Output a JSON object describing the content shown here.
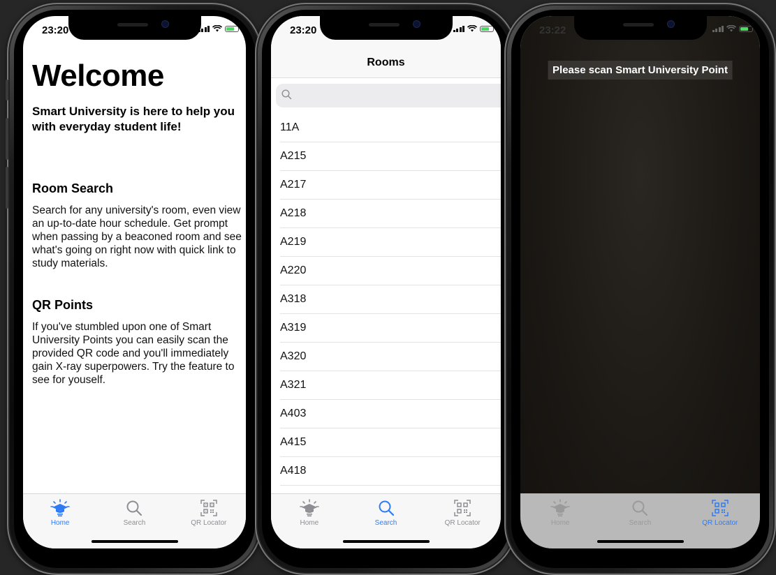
{
  "colors": {
    "accent": "#2f7bf5",
    "inactive": "#8e8e93",
    "battery": "#4cd964"
  },
  "tabs": [
    {
      "label": "Home",
      "icon": "graduation-cap-lamp-icon"
    },
    {
      "label": "Search",
      "icon": "magnifier-icon"
    },
    {
      "label": "QR Locator",
      "icon": "qr-code-icon"
    }
  ],
  "screen1": {
    "time": "23:20",
    "title": "Welcome",
    "subtitle": "Smart University is here to help you with everyday student life!",
    "sections": [
      {
        "heading": "Room Search",
        "body": "Search for any university's room, even view an up-to-date hour schedule. Get prompt when passing by a beaconed room and see what's going on right now with quick link to study materials."
      },
      {
        "heading": "QR Points",
        "body": "If you've stumbled upon one of Smart University Points you can easily scan the provided QR code and you'll immediately gain X-ray superpowers. Try the feature to see for youself."
      }
    ]
  },
  "screen2": {
    "time": "23:20",
    "nav_title": "Rooms",
    "search_placeholder": "",
    "rooms": [
      "11A",
      "A215",
      "A217",
      "A218",
      "A219",
      "A220",
      "A318",
      "A319",
      "A320",
      "A321",
      "A403",
      "A415",
      "A418"
    ]
  },
  "screen3": {
    "time": "23:22",
    "prompt": "Please scan Smart University Point"
  }
}
